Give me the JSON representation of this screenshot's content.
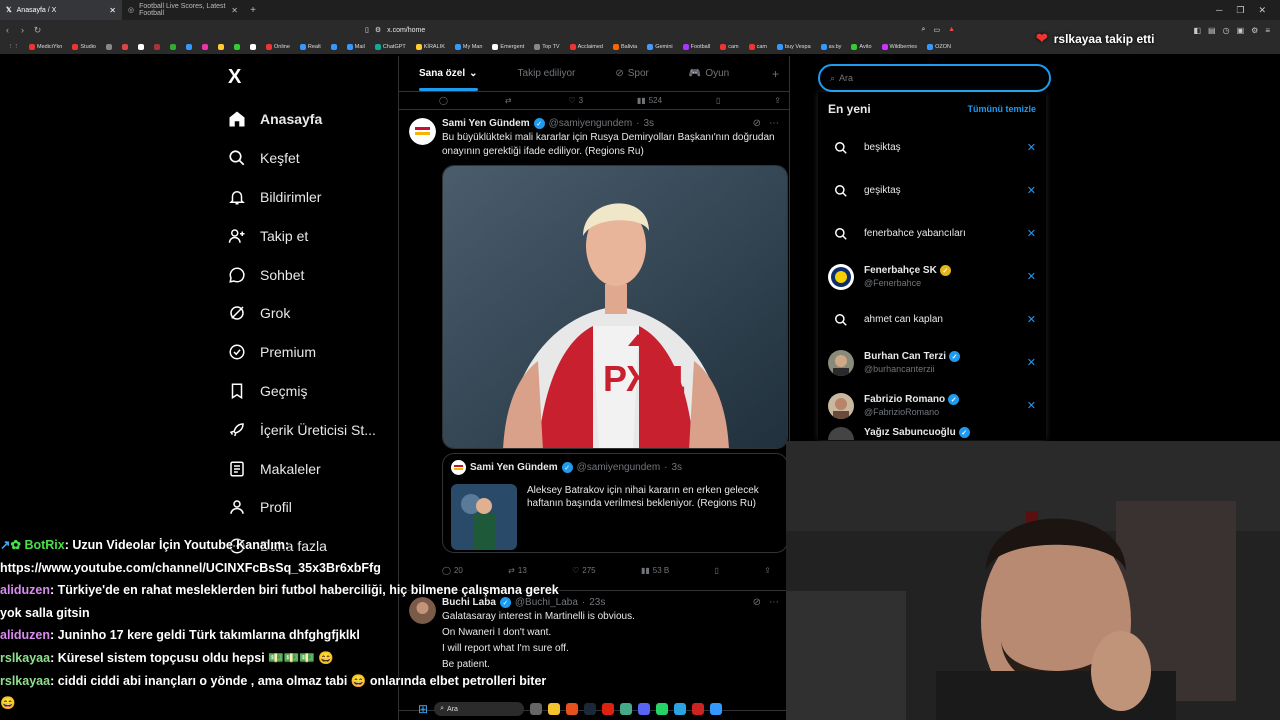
{
  "browser": {
    "tabs": [
      {
        "title": "Anasayfa / X",
        "active": true
      },
      {
        "title": "Football Live Scores, Latest Football",
        "active": false
      }
    ],
    "url": "x.com/home",
    "bookmarks": [
      "MediciYkn",
      "Studio",
      "Online",
      "Realt",
      "Mail",
      "ChatGPT",
      "KİRALIK",
      "My Man",
      "Emergent",
      "Top TV",
      "Acclaimed",
      "Balivia",
      "Gemini",
      "Football",
      "cam",
      "cam",
      "buy Vespa",
      "av.by",
      "Avito",
      "Wildberries",
      "OZON"
    ]
  },
  "notification": "rslkayaa takip etti",
  "nav": {
    "logo": "X",
    "items": [
      {
        "label": "Anasayfa",
        "icon": "home-icon",
        "active": true
      },
      {
        "label": "Keşfet",
        "icon": "search-icon"
      },
      {
        "label": "Bildirimler",
        "icon": "bell-icon"
      },
      {
        "label": "Takip et",
        "icon": "follow-icon"
      },
      {
        "label": "Sohbet",
        "icon": "chat-icon"
      },
      {
        "label": "Grok",
        "icon": "grok-icon"
      },
      {
        "label": "Premium",
        "icon": "premium-icon"
      },
      {
        "label": "Geçmiş",
        "icon": "bookmark-icon"
      },
      {
        "label": "İçerik Üreticisi St...",
        "icon": "rocket-icon"
      },
      {
        "label": "Makaleler",
        "icon": "article-icon"
      },
      {
        "label": "Profil",
        "icon": "profile-icon"
      },
      {
        "label": "Daha fazla",
        "icon": "more-icon"
      }
    ]
  },
  "timeline": {
    "tabs": [
      "Sana özel",
      "Takip ediliyor",
      "Spor",
      "Oyun"
    ],
    "prev_actions": {
      "replies": "",
      "reposts": "",
      "likes": "3",
      "views": "524"
    },
    "tweets": [
      {
        "name": "Sami Yen Gündem",
        "handle": "@samiyengundem",
        "time": "3s",
        "text": "Bu büyüklükteki mali kararlar için Rusya Demiryolları Başkanı'nın doğrudan onayının gerektiği ifade ediliyor. (Regions Ru)",
        "jersey_text": "РЖД",
        "quote": {
          "name": "Sami Yen Gündem",
          "handle": "@samiyengundem",
          "time": "3s",
          "text": "Aleksey Batrakov için nihai kararın en erken gelecek haftanın başında verilmesi bekleniyor. (Regions Ru)"
        },
        "actions": {
          "replies": "20",
          "reposts": "13",
          "likes": "275",
          "views": "53 B"
        }
      },
      {
        "name": "Buchi Laba",
        "handle": "@Buchi_Laba",
        "time": "23s",
        "lines": [
          "Galatasaray interest in Martinelli is obvious.",
          "On Nwaneri I don't want.",
          "I will report what I'm sure off.",
          "Be patient."
        ]
      }
    ]
  },
  "search": {
    "placeholder": "Ara",
    "recent_title": "En yeni",
    "clear_label": "Tümünü temizle",
    "items": [
      {
        "type": "query",
        "text": "beşiktaş"
      },
      {
        "type": "query",
        "text": "geşiktaş"
      },
      {
        "type": "query",
        "text": "fenerbahce yabancıları"
      },
      {
        "type": "user",
        "name": "Fenerbahçe SK",
        "handle": "@Fenerbahce",
        "badge": "gold"
      },
      {
        "type": "query",
        "text": "ahmet can kaplan"
      },
      {
        "type": "user",
        "name": "Burhan Can Terzi",
        "handle": "@burhancanterzii",
        "badge": "blue"
      },
      {
        "type": "user",
        "name": "Fabrizio Romano",
        "handle": "@FabrizioRomano",
        "badge": "blue"
      },
      {
        "type": "user",
        "name": "Yağız Sabuncuoğlu",
        "handle": "",
        "badge": "blue"
      }
    ]
  },
  "chat": [
    {
      "user": "BotRix",
      "msg": "Uzun Videolar İçin Youtube Kanalım: https://www.youtube.com/channel/UCINXFcBsSq_35x3Br6xbFfg"
    },
    {
      "user": "aliduzen",
      "msg": "Türkiye'de en rahat mesleklerden biri futbol haberciliği, hiç bilmene çalışmana gerek yok salla gitsin"
    },
    {
      "user": "aliduzen",
      "msg": "Juninho 17 kere geldi Türk takımlarına dhfghgfjklkl"
    },
    {
      "user": "rslkayaa",
      "msg": "Küresel sistem topçusu oldu hepsi 💵💵💵 😄"
    },
    {
      "user": "rslkayaa",
      "msg": "ciddi ciddi abi inançları o yönde , ama olmaz tabi 😄 onlarında elbet petrolleri biter 😄"
    }
  ],
  "taskbar": {
    "search_placeholder": "Ara"
  }
}
